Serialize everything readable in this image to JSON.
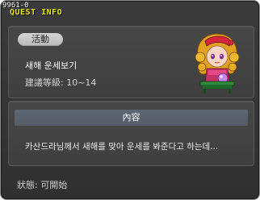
{
  "window": {
    "quest_id": "9961-0",
    "title": "QUEST INFO"
  },
  "quest": {
    "type_badge": "活動",
    "name": "새해 운세보기",
    "level_range": "建議等級: 10~14",
    "npc_icon": "fortune-teller-npc"
  },
  "content": {
    "header": "內容",
    "description": "카산드라님께서 새해를 맞아 운세를 봐준다고 하는데..."
  },
  "status": "狀態: 可開始",
  "colors": {
    "window_bg": "#333333",
    "title_text": "#e8e818",
    "header_bar": "#58616c",
    "badge_bg": "#c7c7c7"
  }
}
